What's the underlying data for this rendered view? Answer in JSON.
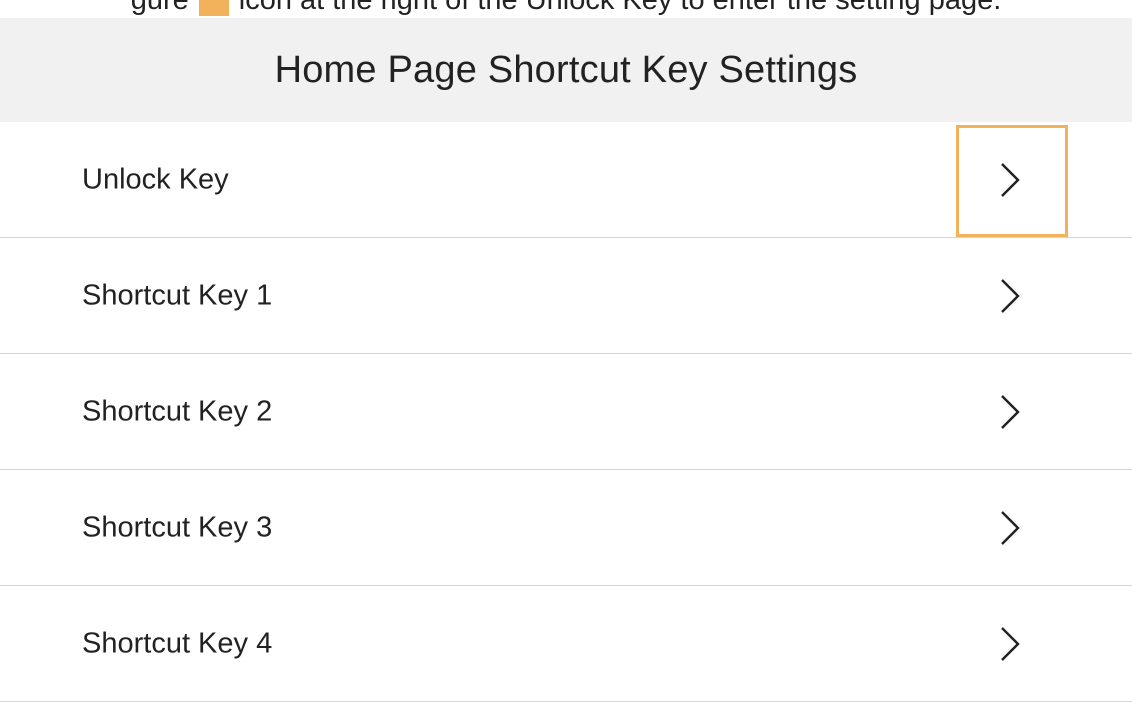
{
  "caption": {
    "prefix": "gure",
    "suffix": "icon at the right of the Unlock Key to enter the setting page."
  },
  "header": {
    "title": "Home Page Shortcut Key Settings"
  },
  "list": {
    "items": [
      {
        "label": "Unlock Key",
        "icon": "chevron-right-icon",
        "highlighted": true
      },
      {
        "label": "Shortcut Key 1",
        "icon": "chevron-right-icon"
      },
      {
        "label": "Shortcut Key 2",
        "icon": "chevron-right-icon"
      },
      {
        "label": "Shortcut Key 3",
        "icon": "chevron-right-icon"
      },
      {
        "label": "Shortcut Key 4",
        "icon": "chevron-right-icon"
      }
    ]
  },
  "colors": {
    "header_background": "#f1f1f1",
    "highlight": "#f2b25c",
    "divider": "#d5d5d5",
    "text": "#222222"
  }
}
